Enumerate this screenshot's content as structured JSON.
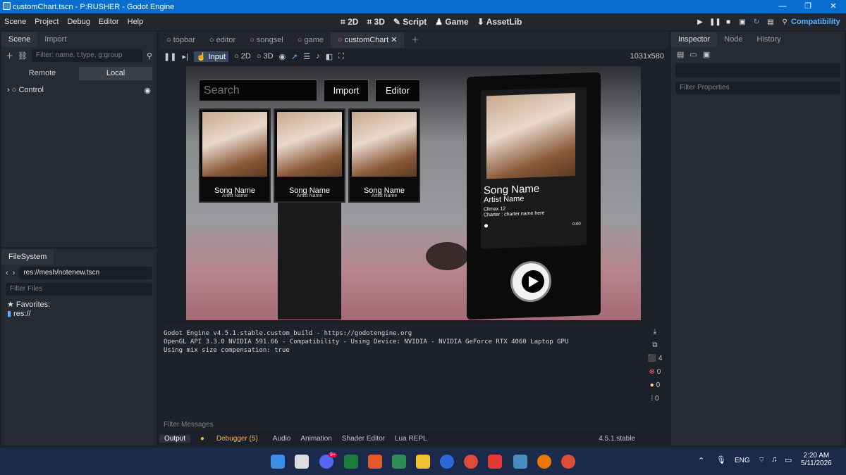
{
  "window": {
    "title": "customChart.tscn - P:RUSHER - Godot Engine",
    "controls": [
      "—",
      "❐",
      "✕"
    ]
  },
  "menu": [
    "Scene",
    "Project",
    "Debug",
    "Editor",
    "Help"
  ],
  "main_screens": [
    "2D",
    "3D",
    "Script",
    "Game",
    "AssetLib"
  ],
  "renderer": "Compatibility",
  "scene_dock": {
    "tabs": [
      "Scene",
      "Import"
    ],
    "filter_placeholder": "Filter: name, t:type, g:group",
    "remote": "Remote",
    "local": "Local",
    "root": "Control"
  },
  "filesystem": {
    "tab": "FileSystem",
    "path": "res://mesh/notenew.tscn",
    "filter_placeholder": "Filter Files",
    "favorites": "Favorites:",
    "res": "res://"
  },
  "scene_tabs": [
    "topbar",
    "editor",
    "songsel",
    "game",
    "customChart"
  ],
  "toolbar": {
    "input": "Input",
    "d2": "2D",
    "d3": "3D",
    "size": "1031x580"
  },
  "game": {
    "search_placeholder": "Search",
    "import": "Import",
    "editor": "Editor",
    "cards": [
      {
        "name": "Song Name",
        "artist": "Artist Name"
      },
      {
        "name": "Song Name",
        "artist": "Artist Name"
      },
      {
        "name": "Song Name",
        "artist": "Artist Name"
      }
    ],
    "detail": {
      "name": "Song Name",
      "artist": "Artist Name",
      "climax": "Climax 12",
      "charter": "Charter : charter name here",
      "time": "0:00"
    }
  },
  "output": {
    "lines": [
      "Godot Engine v4.5.1.stable.custom_build - https://godotengine.org",
      "OpenGL API 3.3.0 NVIDIA 591.66 - Compatibility - Using Device: NVIDIA - NVIDIA GeForce RTX 4060 Laptop GPU",
      "",
      "Using mix size compensation: true"
    ],
    "filter_placeholder": "Filter Messages",
    "counts": {
      "messages": "4",
      "errors": "0",
      "warnings": "0",
      "info": "0"
    }
  },
  "bottom_tabs": [
    "Output",
    "Debugger (5)",
    "Audio",
    "Animation",
    "Shader Editor",
    "Lua REPL"
  ],
  "version": "4.5.1.stable",
  "inspector": {
    "tabs": [
      "Inspector",
      "Node",
      "History"
    ],
    "filter_placeholder": "Filter Properties"
  },
  "taskbar": {
    "lang": "ENG",
    "time": "2:20 AM",
    "date": "5/11/2026",
    "badge": "9+"
  }
}
